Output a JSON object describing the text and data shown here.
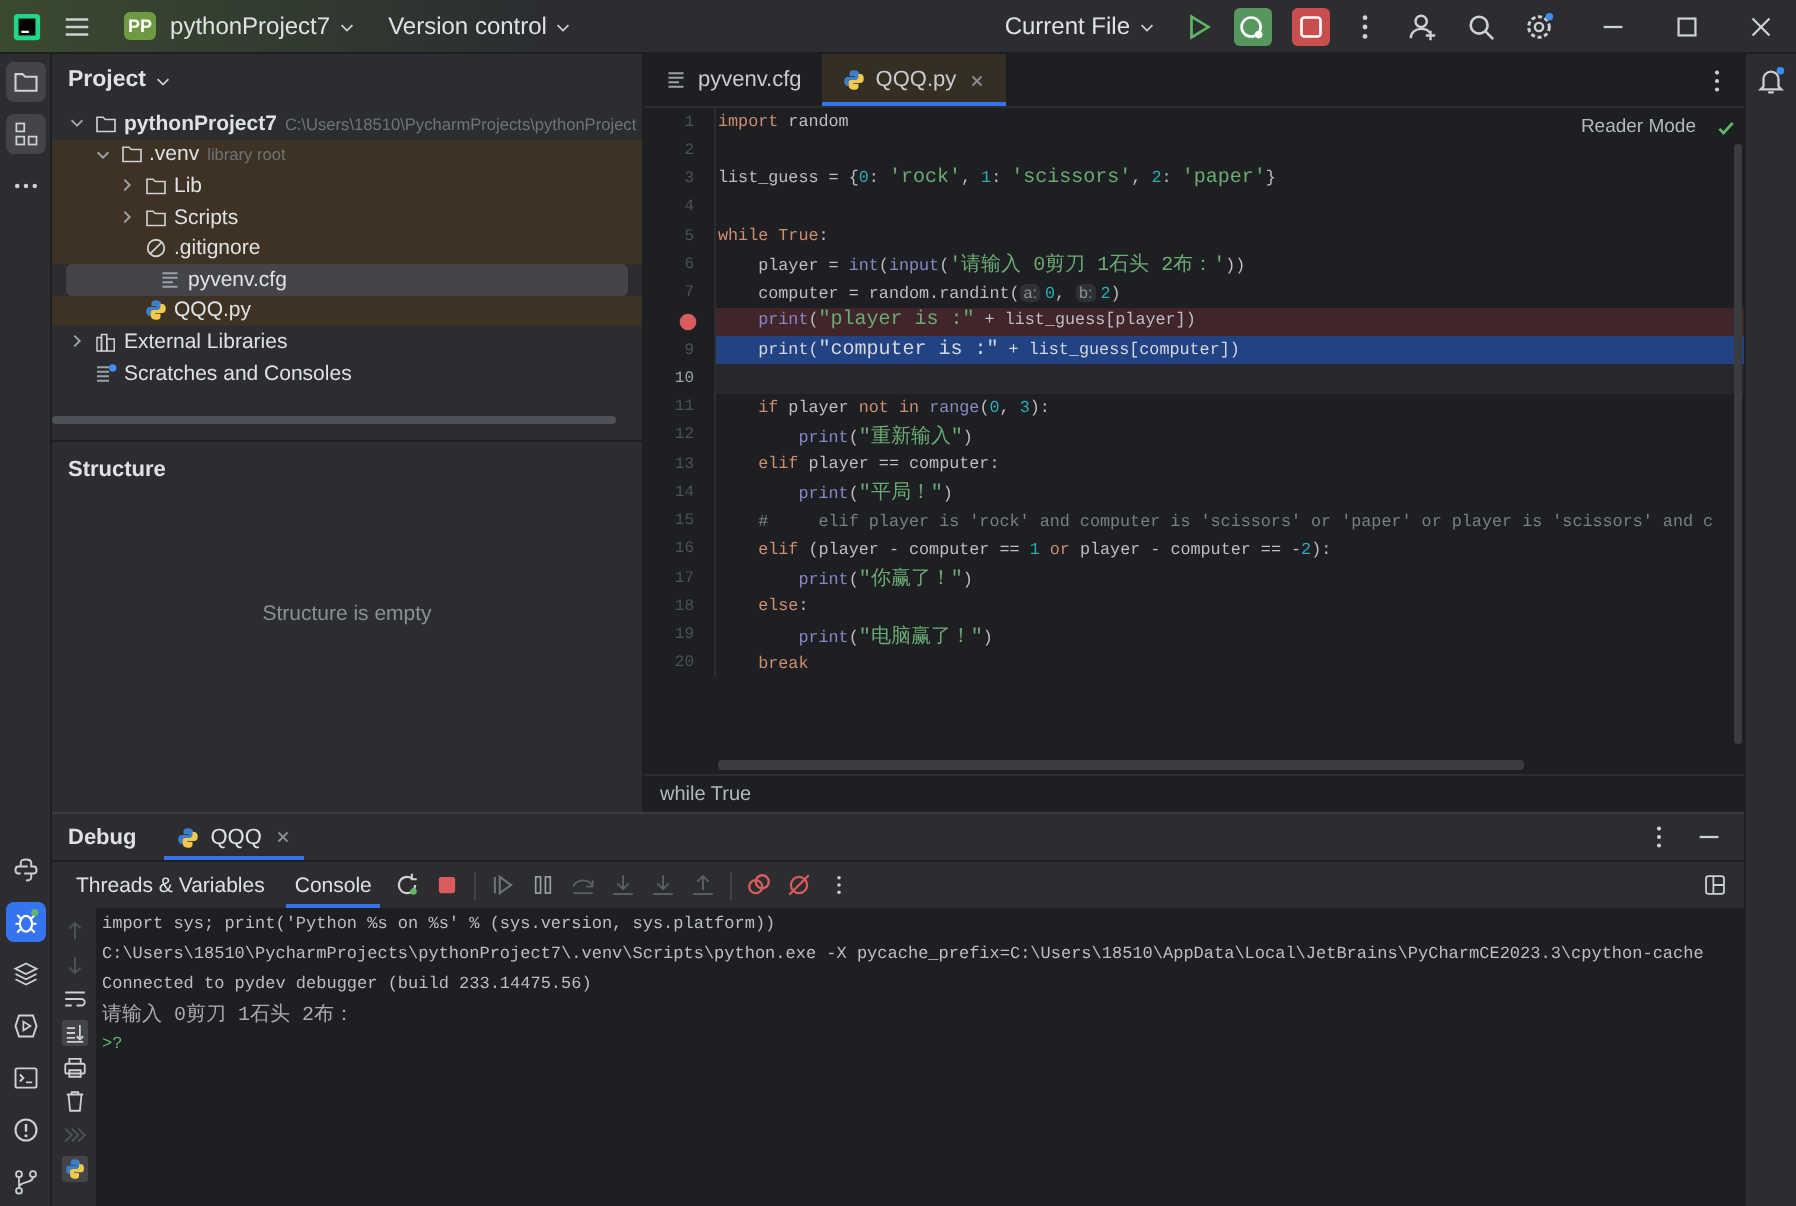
{
  "title_bar": {
    "project_badge": "PP",
    "project": "pythonProject7",
    "vcs": "Version control",
    "run_config": "Current File"
  },
  "tool_strip_top": [
    {
      "kind": "project",
      "selected": true
    },
    {
      "kind": "structure",
      "selected": true
    },
    {
      "kind": "more",
      "selected": false
    }
  ],
  "tool_strip_bottom": [
    {
      "kind": "python_console",
      "selected": false
    },
    {
      "kind": "debug",
      "selected": true
    },
    {
      "kind": "layers",
      "selected": false
    },
    {
      "kind": "run",
      "selected": false
    },
    {
      "kind": "terminal",
      "selected": false
    },
    {
      "kind": "problems",
      "selected": false
    },
    {
      "kind": "git",
      "selected": false
    }
  ],
  "project_panel": {
    "title": "Project",
    "tree": [
      {
        "label": "pythonProject7",
        "hint": "C:\\Users\\18510\\PycharmProjects\\pythonProject",
        "kind": "folder",
        "expanded": true,
        "selected": false,
        "highlighted": false,
        "children": [
          {
            "label": ".venv",
            "hint": "library root",
            "kind": "folder",
            "expanded": true,
            "selected": false,
            "highlighted": true,
            "children": [
              {
                "label": "Lib",
                "kind": "folder",
                "expanded": false,
                "selected": false,
                "highlighted": true
              },
              {
                "label": "Scripts",
                "kind": "folder",
                "expanded": false,
                "selected": false,
                "highlighted": true
              },
              {
                "label": ".gitignore",
                "kind": "ignore",
                "selected": false,
                "highlighted": true
              },
              {
                "label": "pyvenv.cfg",
                "kind": "text",
                "selected": true,
                "highlighted": true
              },
              {
                "label": "QQQ.py",
                "kind": "python",
                "selected": false,
                "highlighted": true
              }
            ]
          }
        ]
      },
      {
        "label": "External Libraries",
        "kind": "library",
        "expanded": false,
        "selected": false,
        "highlighted": false
      },
      {
        "label": "Scratches and Consoles",
        "kind": "scratch",
        "selected": false,
        "highlighted": false
      }
    ]
  },
  "structure_panel": {
    "title": "Structure",
    "empty_text": "Structure is empty"
  },
  "editor": {
    "tabs": [
      {
        "label": "pyvenv.cfg",
        "kind": "text",
        "selected": false
      },
      {
        "label": "QQQ.py",
        "kind": "python",
        "selected": true
      }
    ],
    "reader_mode": "Reader Mode",
    "breadcrumb": "while True",
    "lines": [
      {
        "number": "1",
        "breakpoint": false,
        "execution": false,
        "current": false,
        "tokens": [
          {
            "kind": "kw",
            "text": "import"
          },
          {
            "kind": "pl",
            "text": " random"
          }
        ]
      },
      {
        "number": "2",
        "breakpoint": false,
        "execution": false,
        "current": false
      },
      {
        "number": "3",
        "breakpoint": false,
        "execution": false,
        "current": false,
        "tokens": [
          {
            "kind": "pl",
            "text": "list_guess = {"
          },
          {
            "kind": "num",
            "text": "0"
          },
          {
            "kind": "pl",
            "text": ": "
          },
          {
            "kind": "str",
            "text": "'rock'"
          },
          {
            "kind": "pl",
            "text": ", "
          },
          {
            "kind": "num",
            "text": "1"
          },
          {
            "kind": "pl",
            "text": ": "
          },
          {
            "kind": "str",
            "text": "'scissors'"
          },
          {
            "kind": "pl",
            "text": ", "
          },
          {
            "kind": "num",
            "text": "2"
          },
          {
            "kind": "pl",
            "text": ": "
          },
          {
            "kind": "str",
            "text": "'paper'"
          },
          {
            "kind": "pl",
            "text": "}"
          }
        ]
      },
      {
        "number": "4",
        "breakpoint": false,
        "execution": false,
        "current": false
      },
      {
        "number": "5",
        "breakpoint": false,
        "execution": false,
        "current": false,
        "tokens": [
          {
            "kind": "kw",
            "text": "while "
          },
          {
            "kind": "kw",
            "text": "True"
          },
          {
            "kind": "pl",
            "text": ":"
          }
        ]
      },
      {
        "number": "6",
        "breakpoint": false,
        "execution": false,
        "current": false,
        "tokens": [
          {
            "kind": "pl",
            "text": "    player = "
          },
          {
            "kind": "fn",
            "text": "int"
          },
          {
            "kind": "pl",
            "text": "("
          },
          {
            "kind": "fn",
            "text": "input"
          },
          {
            "kind": "pl",
            "text": "("
          },
          {
            "kind": "str",
            "text": "'请输入 0剪刀 1石头 2布：'"
          },
          {
            "kind": "pl",
            "text": "))"
          }
        ]
      },
      {
        "number": "7",
        "breakpoint": false,
        "execution": false,
        "current": false,
        "tokens": [
          {
            "kind": "pl",
            "text": "    computer = random.randint("
          },
          {
            "kind": "hint",
            "text": "a:"
          },
          {
            "kind": "num",
            "text": "0"
          },
          {
            "kind": "pl",
            "text": ", "
          },
          {
            "kind": "hint",
            "text": "b:"
          },
          {
            "kind": "num",
            "text": "2"
          },
          {
            "kind": "pl",
            "text": ")"
          }
        ]
      },
      {
        "breakpoint": true,
        "execution": false,
        "current": false,
        "tokens": [
          {
            "kind": "fn",
            "text": "    print"
          },
          {
            "kind": "pl",
            "text": "("
          },
          {
            "kind": "str",
            "text": "\"player is :\""
          },
          {
            "kind": "pl",
            "text": " + list_guess[player])"
          }
        ]
      },
      {
        "number": "9",
        "breakpoint": false,
        "execution": true,
        "current": false,
        "tokens": [
          {
            "kind": "fn",
            "text": "    print"
          },
          {
            "kind": "pl",
            "text": "("
          },
          {
            "kind": "str",
            "text": "\"computer is :\""
          },
          {
            "kind": "pl",
            "text": " + list_guess[computer])"
          }
        ]
      },
      {
        "number": "10",
        "breakpoint": false,
        "execution": false,
        "current": true
      },
      {
        "number": "11",
        "breakpoint": false,
        "execution": false,
        "current": false,
        "tokens": [
          {
            "kind": "kw",
            "text": "    if"
          },
          {
            "kind": "pl",
            "text": " player "
          },
          {
            "kind": "kw",
            "text": "not in "
          },
          {
            "kind": "fn",
            "text": "range"
          },
          {
            "kind": "pl",
            "text": "("
          },
          {
            "kind": "num",
            "text": "0"
          },
          {
            "kind": "pl",
            "text": ", "
          },
          {
            "kind": "num",
            "text": "3"
          },
          {
            "kind": "pl",
            "text": "):"
          }
        ]
      },
      {
        "number": "12",
        "breakpoint": false,
        "execution": false,
        "current": false,
        "tokens": [
          {
            "kind": "fn",
            "text": "        print"
          },
          {
            "kind": "pl",
            "text": "("
          },
          {
            "kind": "str",
            "text": "\"重新输入\""
          },
          {
            "kind": "pl",
            "text": ")"
          }
        ]
      },
      {
        "number": "13",
        "breakpoint": false,
        "execution": false,
        "current": false,
        "tokens": [
          {
            "kind": "kw",
            "text": "    elif"
          },
          {
            "kind": "pl",
            "text": " player == computer:"
          }
        ]
      },
      {
        "number": "14",
        "breakpoint": false,
        "execution": false,
        "current": false,
        "tokens": [
          {
            "kind": "fn",
            "text": "        print"
          },
          {
            "kind": "pl",
            "text": "("
          },
          {
            "kind": "str",
            "text": "\"平局！\""
          },
          {
            "kind": "pl",
            "text": ")"
          }
        ]
      },
      {
        "number": "15",
        "breakpoint": false,
        "execution": false,
        "current": false,
        "tokens": [
          {
            "kind": "cm",
            "text": "    #     elif player is 'rock' and computer is 'scissors' or 'paper' or player is 'scissors' and c"
          }
        ]
      },
      {
        "number": "16",
        "breakpoint": false,
        "execution": false,
        "current": false,
        "tokens": [
          {
            "kind": "kw",
            "text": "    elif"
          },
          {
            "kind": "pl",
            "text": " (player - computer == "
          },
          {
            "kind": "num",
            "text": "1"
          },
          {
            "kind": "kw",
            "text": " or"
          },
          {
            "kind": "pl",
            "text": " player - computer == -"
          },
          {
            "kind": "num",
            "text": "2"
          },
          {
            "kind": "pl",
            "text": "):"
          }
        ]
      },
      {
        "number": "17",
        "breakpoint": false,
        "execution": false,
        "current": false,
        "tokens": [
          {
            "kind": "fn",
            "text": "        print"
          },
          {
            "kind": "pl",
            "text": "("
          },
          {
            "kind": "str",
            "text": "\"你赢了！\""
          },
          {
            "kind": "pl",
            "text": ")"
          }
        ]
      },
      {
        "number": "18",
        "breakpoint": false,
        "execution": false,
        "current": false,
        "tokens": [
          {
            "kind": "kw",
            "text": "    else"
          },
          {
            "kind": "pl",
            "text": ":"
          }
        ]
      },
      {
        "number": "19",
        "breakpoint": false,
        "execution": false,
        "current": false,
        "tokens": [
          {
            "kind": "fn",
            "text": "        print"
          },
          {
            "kind": "pl",
            "text": "("
          },
          {
            "kind": "str",
            "text": "\"电脑赢了！\""
          },
          {
            "kind": "pl",
            "text": ")"
          }
        ]
      },
      {
        "number": "20",
        "breakpoint": false,
        "execution": false,
        "current": false,
        "tokens": [
          {
            "kind": "kw",
            "text": "    break"
          }
        ]
      }
    ]
  },
  "debug_panel": {
    "title": "Debug",
    "tabs": [
      {
        "label": "QQQ",
        "selected": true
      }
    ],
    "subtabs": [
      {
        "label": "Threads & Variables",
        "selected": false
      },
      {
        "label": "Console",
        "selected": true
      }
    ],
    "console": [
      {
        "kind": "command",
        "text": "import sys; print('Python %s on %s' % (sys.version, sys.platform))"
      },
      {
        "kind": "command",
        "text": "C:\\Users\\18510\\PycharmProjects\\pythonProject7\\.venv\\Scripts\\python.exe -X pycache_prefix=C:\\Users\\18510\\AppData\\Local\\JetBrains\\PyCharmCE2023.3\\cpython-cache"
      },
      {
        "kind": "command",
        "text": "Connected to pydev debugger (build 233.14475.56)"
      },
      {
        "kind": "output",
        "text": "请输入 0剪刀 1石头 2布："
      },
      {
        "kind": "prompt",
        "text": ">?"
      }
    ]
  }
}
